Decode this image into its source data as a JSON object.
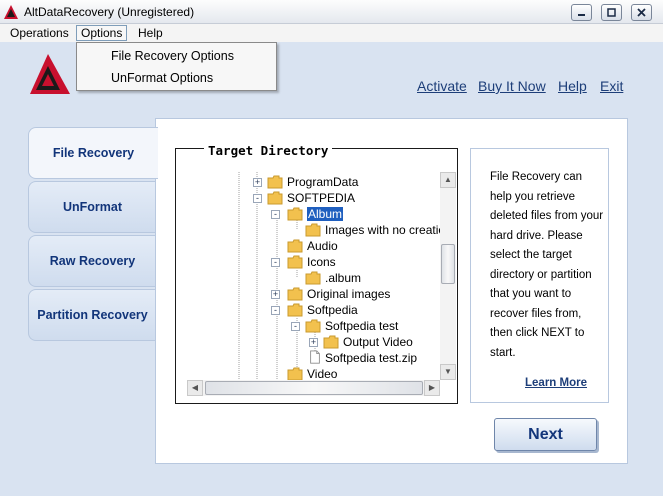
{
  "window": {
    "title": "AltDataRecovery (Unregistered)"
  },
  "menubar": {
    "items": [
      "Operations",
      "Options",
      "Help"
    ]
  },
  "options_menu": {
    "items": [
      "File Recovery Options",
      "UnFormat Options"
    ]
  },
  "header_links": [
    "Activate",
    "Buy It Now",
    "Help",
    "Exit"
  ],
  "nav": {
    "tabs": [
      "File Recovery",
      "UnFormat",
      "Raw Recovery",
      "Partition Recovery"
    ],
    "active": "File Recovery"
  },
  "target_directory": {
    "title": "Target Directory",
    "tree": [
      {
        "label": "ProgramData",
        "expander": "+"
      },
      {
        "label": "SOFTPEDIA",
        "expander": "-"
      },
      {
        "label": "Album",
        "expander": "-",
        "selected": true
      },
      {
        "label": "Images with no creatio",
        "expander": ""
      },
      {
        "label": "Audio",
        "expander": ""
      },
      {
        "label": "Icons",
        "expander": "-"
      },
      {
        "label": ".album",
        "expander": ""
      },
      {
        "label": "Original images",
        "expander": "+"
      },
      {
        "label": "Softpedia",
        "expander": "-"
      },
      {
        "label": "Softpedia test",
        "expander": "-"
      },
      {
        "label": "Output Video",
        "expander": "+"
      },
      {
        "label": "Softpedia test.zip",
        "expander": ""
      },
      {
        "label": "Video",
        "expander": ""
      }
    ]
  },
  "info": {
    "text": "File Recovery can help you retrieve deleted files from your hard drive. Please select the target directory or partition that you want to recover files from, then click NEXT to start.",
    "learn_more": "Learn More"
  },
  "actions": {
    "next_label": "Next"
  },
  "colors": {
    "accent": "#12357a",
    "link": "#1d3e79",
    "selection": "#1f5fbf",
    "background": "#d9e3f1"
  },
  "icons": {
    "app": "altdatarecovery-logo-icon",
    "folder": "folder-icon",
    "file": "file-icon"
  }
}
